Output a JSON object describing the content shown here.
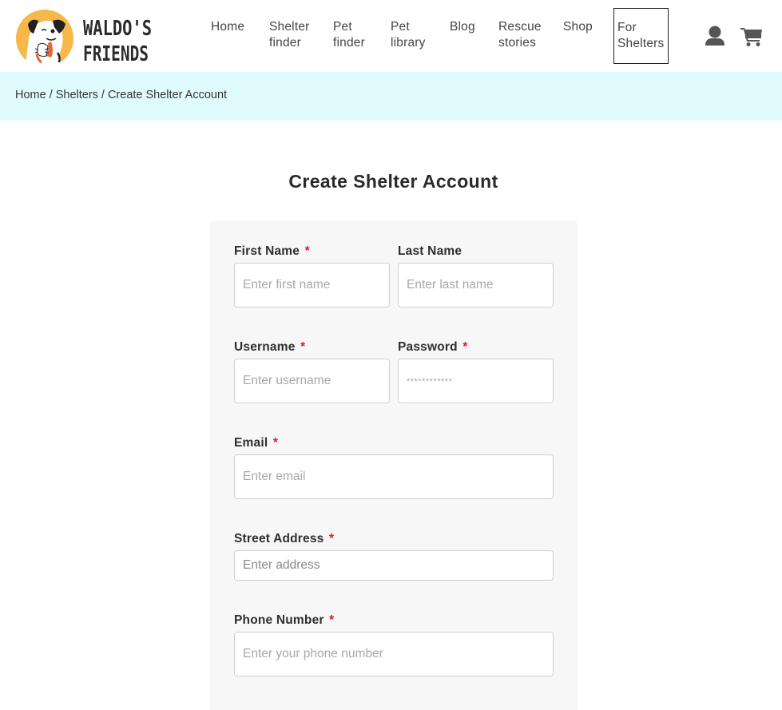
{
  "brand": {
    "name_line1": "WALDO'S",
    "name_line2": "FRIENDS",
    "colors": {
      "logo_circle": "#f7b84b",
      "accent_orange": "#e8663a",
      "breadcrumb_bg": "#e0fbfd",
      "required": "#e0182d",
      "panel_bg": "#f7f7f7"
    }
  },
  "nav": {
    "items": [
      {
        "label": "Home"
      },
      {
        "label": "Shelter\nfinder"
      },
      {
        "label": "Pet\nfinder"
      },
      {
        "label": "Pet\nlibrary"
      },
      {
        "label": "Blog"
      },
      {
        "label": "Rescue\nstories"
      },
      {
        "label": "Shop"
      },
      {
        "label": "For\nShelters",
        "active": true
      }
    ],
    "icons": {
      "account": "user-icon",
      "cart": "cart-icon"
    }
  },
  "breadcrumb": {
    "items": [
      "Home",
      "Shelters",
      "Create Shelter Account"
    ],
    "separator": "/"
  },
  "page": {
    "title": "Create Shelter Account"
  },
  "form": {
    "required_mark": "*",
    "fields": {
      "first_name": {
        "label": "First Name",
        "placeholder": "Enter first name",
        "value": "",
        "required": true
      },
      "last_name": {
        "label": "Last Name",
        "placeholder": "Enter last name",
        "value": "",
        "required": false
      },
      "username": {
        "label": "Username",
        "placeholder": "Enter username",
        "value": "",
        "required": true
      },
      "password": {
        "label": "Password",
        "placeholder": "************",
        "value": "",
        "required": true
      },
      "email": {
        "label": "Email",
        "placeholder": "Enter email",
        "value": "",
        "required": true
      },
      "street_address": {
        "label": "Street Address",
        "placeholder": "Enter address",
        "value": "",
        "required": true
      },
      "phone_number": {
        "label": "Phone Number",
        "placeholder": "Enter your phone number",
        "value": "",
        "required": true
      }
    }
  }
}
